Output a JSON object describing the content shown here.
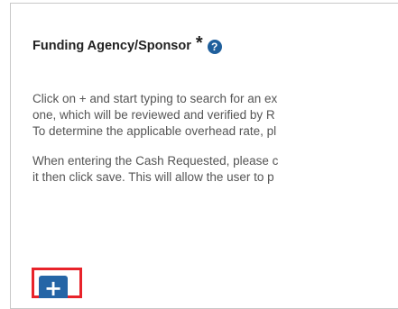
{
  "section": {
    "title": "Funding Agency/Sponsor",
    "required_marker": "*",
    "help_icon_glyph": "?"
  },
  "instructions": {
    "paragraph1": [
      "Click on + and start typing to search for an ex",
      "one, which will be reviewed and verified by R",
      "To determine the applicable overhead rate, pl"
    ],
    "paragraph2": [
      "When entering the Cash Requested, please c",
      "it then click save. This will allow the user to p"
    ]
  },
  "add_button": {
    "glyph": "+"
  },
  "colors": {
    "accent": "#2565a6",
    "highlight": "#e8232a",
    "body_text": "#555555",
    "heading_text": "#222222"
  }
}
